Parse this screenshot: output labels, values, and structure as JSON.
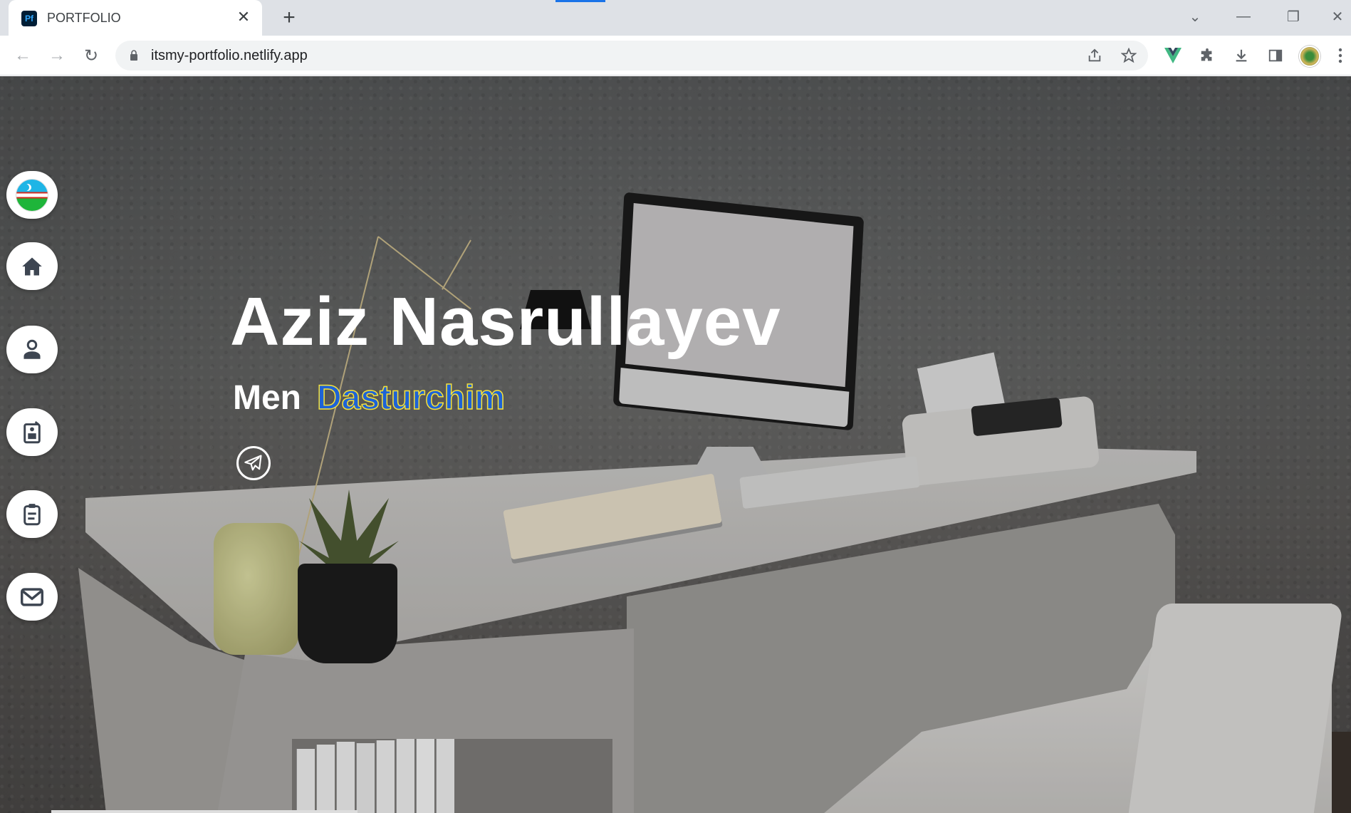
{
  "browser": {
    "tab": {
      "favicon": "Pf",
      "title": "PORTFOLIO",
      "close": "✕"
    },
    "new_tab": "+",
    "window_controls": {
      "collapse": "⌄",
      "minimize": "—",
      "restore": "❐",
      "close": "✕"
    },
    "nav": {
      "back": "←",
      "forward": "→",
      "reload": "↻"
    },
    "address": {
      "url": "itsmy-portfolio.netlify.app"
    },
    "icons": [
      "share-icon",
      "star-icon",
      "vue-devtools-icon",
      "extensions-icon",
      "download-icon",
      "sidepanel-icon",
      "profile-avatar",
      "menu-icon"
    ]
  },
  "hero": {
    "name": "Aziz Nasrullayev",
    "subtitle_static": "Men",
    "subtitle_typed": "Dasturchim",
    "typed_colors": {
      "fill": "#1e63d6",
      "stroke": "#f5e13a"
    }
  },
  "sidebar": {
    "items": [
      {
        "name": "language-flag-uz",
        "icon": "uzbekistan-flag-icon"
      },
      {
        "name": "home",
        "icon": "home-icon"
      },
      {
        "name": "about",
        "icon": "user-icon"
      },
      {
        "name": "resume",
        "icon": "resume-icon"
      },
      {
        "name": "portfolio",
        "icon": "clipboard-icon"
      },
      {
        "name": "contact",
        "icon": "mail-icon"
      }
    ]
  },
  "social": [
    {
      "name": "telegram",
      "icon": "telegram-icon"
    }
  ]
}
